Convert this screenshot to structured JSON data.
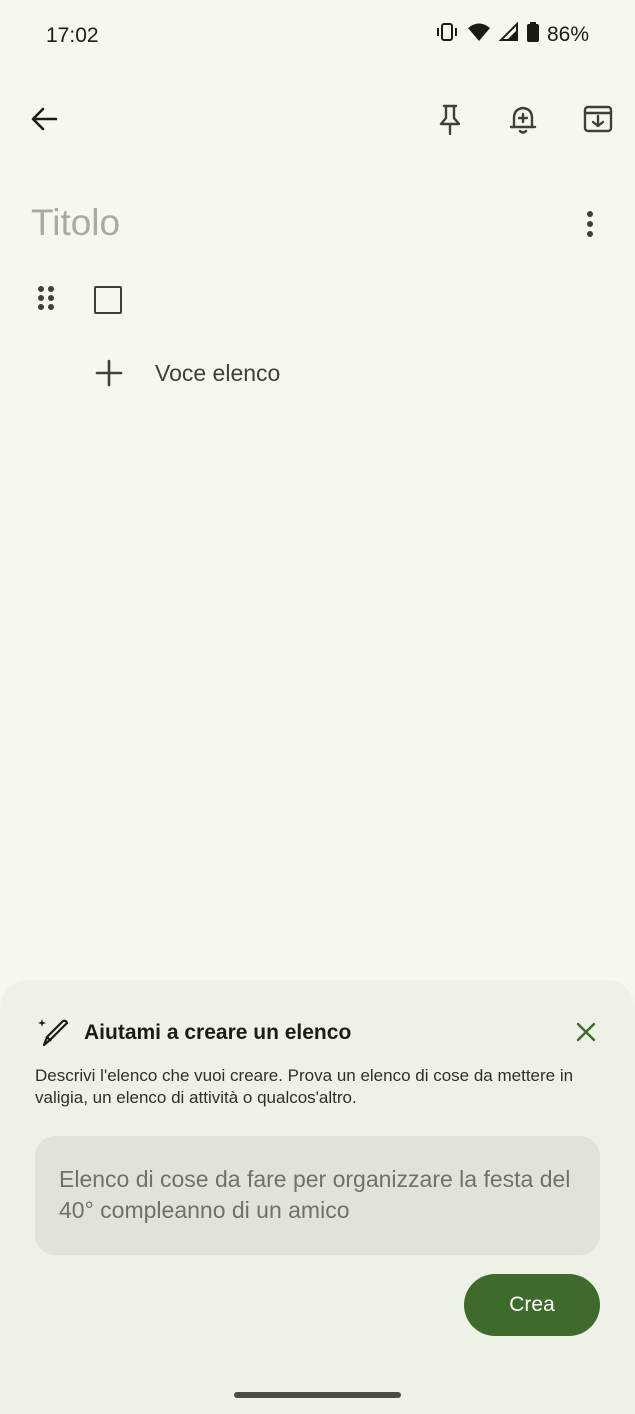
{
  "status_bar": {
    "time": "17:02",
    "battery": "86%",
    "icons": [
      "vibrate-icon",
      "wifi-icon",
      "signal-icon",
      "battery-icon"
    ]
  },
  "toolbar": {
    "back_icon": "arrow-left-icon",
    "pin_icon": "pin-icon",
    "reminder_icon": "bell-plus-icon",
    "archive_icon": "archive-icon"
  },
  "note": {
    "title_placeholder": "Titolo",
    "add_item_label": "Voce elenco"
  },
  "assist_sheet": {
    "title": "Aiutami a creare un elenco",
    "description": "Descrivi l'elenco che vuoi creare. Prova un elenco di cose da mettere in valigia, un elenco di attività o qualcos'altro.",
    "prompt_placeholder": "Elenco di cose da fare per organizzare la festa del 40° compleanno di un amico",
    "create_label": "Crea"
  },
  "colors": {
    "background": "#f6f8ef",
    "sheet": "#eef2e6",
    "accent": "#3e6a2c",
    "close_icon": "#3e6a2c"
  }
}
